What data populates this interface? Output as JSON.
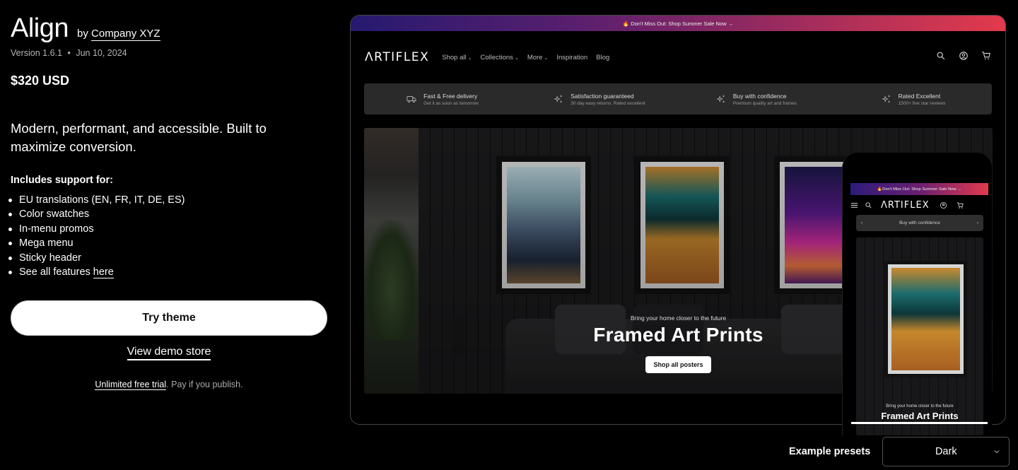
{
  "theme": {
    "title": "Align",
    "by_prefix": "by",
    "developer": "Company XYZ",
    "version": "Version 1.6.1",
    "separator": "•",
    "date": "Jun 10, 2024",
    "price": "$320 USD",
    "tagline": "Modern, performant, and accessible. Built to maximize conversion.",
    "includes_heading": "Includes support for:",
    "features": [
      "EU translations (EN, FR, IT, DE, ES)",
      "Color swatches",
      "In-menu promos",
      "Mega menu",
      "Sticky header"
    ],
    "see_all_prefix": "See all features",
    "see_all_link": "here",
    "try_button": "Try theme",
    "demo_link": "View demo store",
    "trial_link": "Unlimited free trial",
    "trial_suffix": ". Pay if you publish."
  },
  "preview": {
    "announcement": "🔥 Don't Miss Out: Shop Summer Sale Now →",
    "logo": "ΛRTIFLEX",
    "nav": [
      {
        "label": "Shop all",
        "dropdown": true
      },
      {
        "label": "Collections",
        "dropdown": true
      },
      {
        "label": "More",
        "dropdown": true
      },
      {
        "label": "Inspiration",
        "dropdown": false
      },
      {
        "label": "Blog",
        "dropdown": false
      }
    ],
    "header_icons": [
      "search-icon",
      "account-icon",
      "cart-icon"
    ],
    "usps": [
      {
        "icon": "truck-icon",
        "title": "Fast & Free delivery",
        "subtitle": "Get it as soon as tomorrow"
      },
      {
        "icon": "sparkle-icon",
        "title": "Satisfaction guaranteed",
        "subtitle": "30 day easy returns. Rated excellent"
      },
      {
        "icon": "sparkle-icon",
        "title": "Buy with confidence",
        "subtitle": "Premium quality art and frames"
      },
      {
        "icon": "sparkle-icon",
        "title": "Rated Excellent",
        "subtitle": "1500+ five star reviews"
      }
    ],
    "hero": {
      "subtitle": "Bring your home closer to the future",
      "title": "Framed Art Prints",
      "button": "Shop all posters"
    },
    "mobile": {
      "announcement": "🔥Don't Miss Out: Shop Summer Sale Now →",
      "logo": "ΛRTIFLEX",
      "usp": "Buy with confidence",
      "hero_subtitle": "Bring your home closer to the future",
      "hero_title": "Framed Art Prints"
    }
  },
  "presets": {
    "label": "Example presets",
    "selected": "Dark"
  }
}
